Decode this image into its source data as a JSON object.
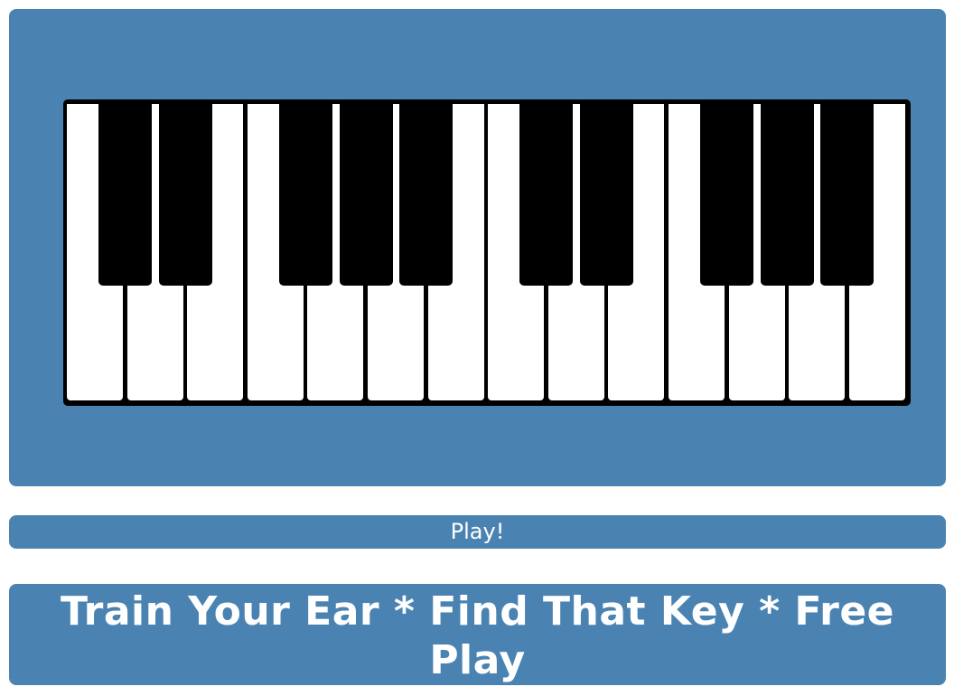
{
  "colors": {
    "panel": "#4a83b2",
    "white_key": "#ffffff",
    "black_key": "#000000",
    "text": "#ffffff"
  },
  "keyboard": {
    "white_key_count": 14,
    "black_key_pattern": [
      "C#",
      "D#",
      "F#",
      "G#",
      "A#",
      "C#",
      "D#",
      "F#",
      "G#",
      "A#"
    ]
  },
  "play_button": {
    "label": "Play!"
  },
  "title": {
    "text": "Train Your Ear * Find That Key * Free Play"
  }
}
